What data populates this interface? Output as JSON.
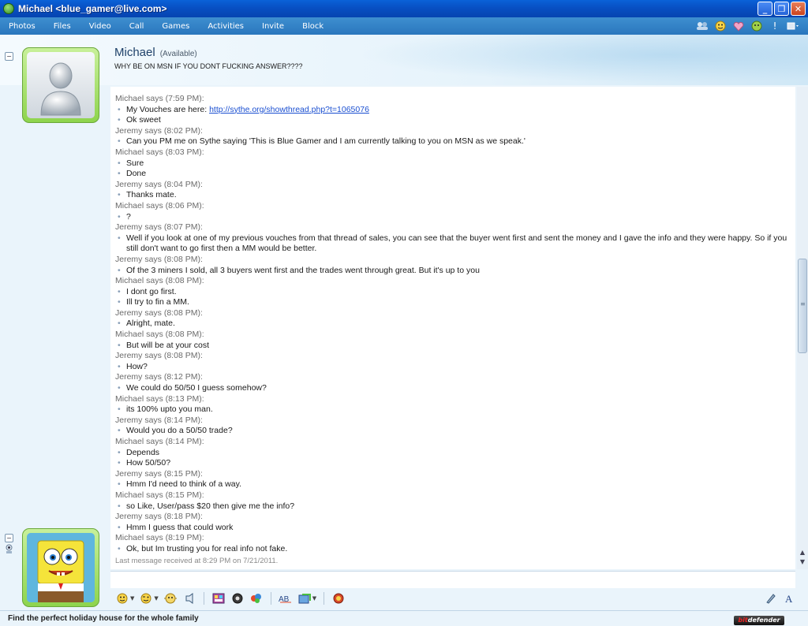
{
  "window": {
    "title": "Michael <blue_gamer@live.com>",
    "buttons": {
      "minimize": "_",
      "maximize": "❐",
      "close": "✕"
    }
  },
  "menu": [
    "Photos",
    "Files",
    "Video",
    "Call",
    "Games",
    "Activities",
    "Invite",
    "Block"
  ],
  "menu_icons": [
    "contacts-icon",
    "emoticon-icon",
    "heart-icon",
    "nudge-icon",
    "alert-icon",
    "more-icon"
  ],
  "contact": {
    "name": "Michael",
    "status": "(Available)",
    "personal_message": "WHY BE ON MSN IF YOU DONT FUCKING ANSWER????"
  },
  "conversation": [
    {
      "kind": "says",
      "text": "Michael says (7:59 PM):"
    },
    {
      "kind": "msg",
      "text": "My Vouches are here: ",
      "link": "http://sythe.org/showthread.php?t=1065076"
    },
    {
      "kind": "msg",
      "text": "Ok sweet"
    },
    {
      "kind": "says",
      "text": "Jeremy says (8:02 PM):"
    },
    {
      "kind": "msg",
      "text": "Can you PM me on Sythe saying 'This is Blue Gamer and I am currently talking to you on MSN as we speak.'"
    },
    {
      "kind": "says",
      "text": "Michael says (8:03 PM):"
    },
    {
      "kind": "msg",
      "text": "Sure"
    },
    {
      "kind": "msg",
      "text": "Done"
    },
    {
      "kind": "says",
      "text": "Jeremy says (8:04 PM):"
    },
    {
      "kind": "msg",
      "text": "Thanks mate."
    },
    {
      "kind": "says",
      "text": "Michael says (8:06 PM):"
    },
    {
      "kind": "msg",
      "text": "?"
    },
    {
      "kind": "says",
      "text": "Jeremy says (8:07 PM):"
    },
    {
      "kind": "msg",
      "text": "Well if you look at one of my previous vouches from that thread of sales, you can see that the buyer went first and sent the money and I gave the info and they were happy. So if you"
    },
    {
      "kind": "cont",
      "text": "still don't want to go first then a MM would be better."
    },
    {
      "kind": "says",
      "text": "Jeremy says (8:08 PM):"
    },
    {
      "kind": "msg",
      "text": "Of the 3 miners I sold, all 3 buyers went first and the trades went through great. But it's up to you"
    },
    {
      "kind": "says",
      "text": "Michael says (8:08 PM):"
    },
    {
      "kind": "msg",
      "text": "I dont go first."
    },
    {
      "kind": "msg",
      "text": "Ill try to fin a MM."
    },
    {
      "kind": "says",
      "text": "Jeremy says (8:08 PM):"
    },
    {
      "kind": "msg",
      "text": "Alright, mate."
    },
    {
      "kind": "says",
      "text": "Michael says (8:08 PM):"
    },
    {
      "kind": "msg",
      "text": "But will be at your cost"
    },
    {
      "kind": "says",
      "text": "Jeremy says (8:08 PM):"
    },
    {
      "kind": "msg",
      "text": "How?"
    },
    {
      "kind": "says",
      "text": "Jeremy says (8:12 PM):"
    },
    {
      "kind": "msg",
      "text": "We could do 50/50 I guess somehow?"
    },
    {
      "kind": "says",
      "text": "Michael says (8:13 PM):"
    },
    {
      "kind": "msg",
      "text": "its 100% upto you man."
    },
    {
      "kind": "says",
      "text": "Jeremy says (8:14 PM):"
    },
    {
      "kind": "msg",
      "text": "Would you do a 50/50 trade?"
    },
    {
      "kind": "says",
      "text": "Michael says (8:14 PM):"
    },
    {
      "kind": "msg",
      "text": "Depends"
    },
    {
      "kind": "msg",
      "text": "How 50/50?"
    },
    {
      "kind": "says",
      "text": "Jeremy says (8:15 PM):"
    },
    {
      "kind": "msg",
      "text": "Hmm I'd need to think of a way."
    },
    {
      "kind": "says",
      "text": "Michael says (8:15 PM):"
    },
    {
      "kind": "msg",
      "text": "so Like, User/pass $20 then give me the info?"
    },
    {
      "kind": "says",
      "text": "Jeremy says (8:18 PM):"
    },
    {
      "kind": "msg",
      "text": "Hmm I guess that could work"
    },
    {
      "kind": "says",
      "text": "Michael says (8:19 PM):"
    },
    {
      "kind": "msg",
      "text": "Ok, but Im trusting you for real info not fake."
    },
    {
      "kind": "note",
      "text": "Last message received at 8:29 PM on 7/21/2011."
    }
  ],
  "toolbar_icons": [
    "emoticon-icon",
    "wink-icon",
    "nudge-icon",
    "voice-clip-icon",
    "background-icon",
    "games-icon",
    "send-icon",
    "font-icon",
    "translate-icon",
    "handwriting-icon",
    "text-icon"
  ],
  "ad": {
    "text": "Find the perfect holiday house for the whole family",
    "badge_prefix": "bit",
    "badge_suffix": "defender"
  }
}
